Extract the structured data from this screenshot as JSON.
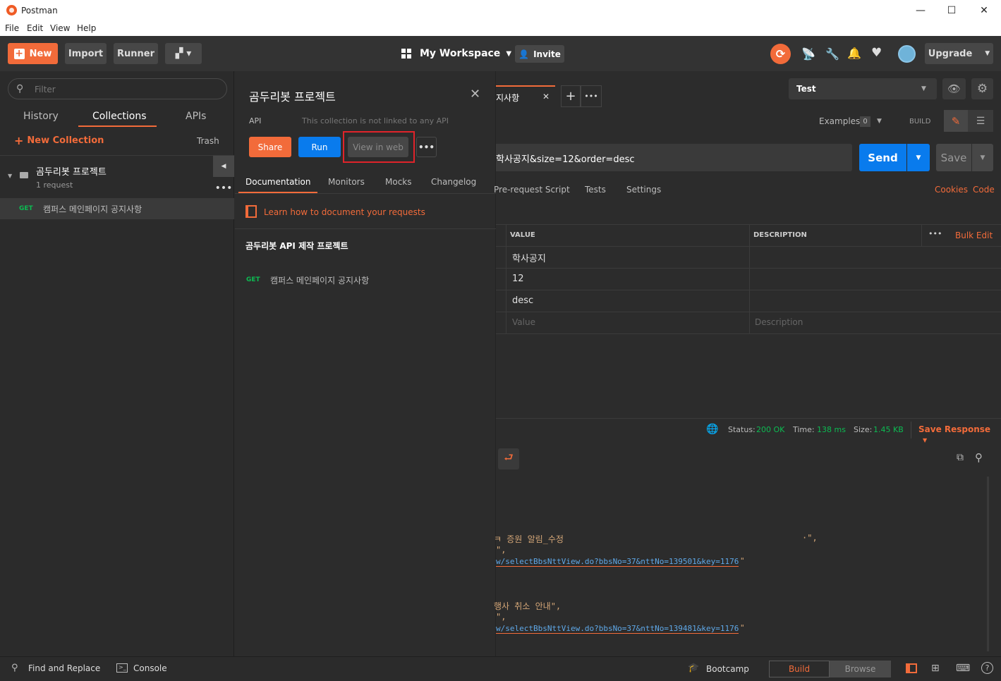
{
  "window": {
    "title": "Postman",
    "minimize": "—",
    "maximize": "☐",
    "close": "✕"
  },
  "menu": [
    "File",
    "Edit",
    "View",
    "Help"
  ],
  "toolbar": {
    "new_label": "New",
    "import_label": "Import",
    "runner_label": "Runner",
    "workspace_label": "My Workspace",
    "invite_label": "Invite",
    "upgrade_label": "Upgrade"
  },
  "sidebar": {
    "filter_placeholder": "Filter",
    "tabs": [
      "History",
      "Collections",
      "APIs"
    ],
    "new_collection": "New Collection",
    "trash": "Trash",
    "collection": {
      "name": "곰두리봇 프로젝트",
      "count": "1 request"
    },
    "request": {
      "method": "GET",
      "name": "캠퍼스 메인페이지 공지사항"
    }
  },
  "panel": {
    "title": "곰두리봇 프로젝트",
    "api_label": "API",
    "api_note": "This collection is not linked to any API",
    "share": "Share",
    "run": "Run",
    "view_web": "View in web",
    "tabs": [
      "Documentation",
      "Monitors",
      "Mocks",
      "Changelog"
    ],
    "learn": "Learn how to document your requests",
    "doc_title": "곰두리봇 API 제작 프로젝트",
    "doc_method": "GET",
    "doc_request": "캠퍼스 메인페이지 공지사항"
  },
  "main": {
    "tab_label": "지사항",
    "env": "Test",
    "examples": "Examples",
    "examples_count": "0",
    "build": "BUILD",
    "url": "학사공지&size=12&order=desc",
    "send": "Send",
    "save": "Save",
    "subtabs": [
      "Pre-request Script",
      "Tests",
      "Settings"
    ],
    "cookies": "Cookies",
    "code": "Code",
    "headers": {
      "value": "VALUE",
      "description": "DESCRIPTION",
      "bulk": "Bulk Edit"
    },
    "rows": [
      "학사공지",
      "12",
      "desc"
    ],
    "placeholders": {
      "value": "Value",
      "description": "Description"
    },
    "status_label": "Status:",
    "status": "200 OK",
    "time_label": "Time:",
    "time": "138 ms",
    "size_label": "Size:",
    "size": "1.45 KB",
    "save_response": "Save Response",
    "body_lines": [
      {
        "text": "ㅋ 증원 알림_수정",
        "tail": "·\","
      },
      {
        "text": "\","
      },
      {
        "link": "w/selectBbsNttView.do?bbsNo=37&nttNo=139501&key=1176",
        "q": "\""
      },
      {
        "text": " 행사 취소 안내\","
      },
      {
        "text": "\","
      },
      {
        "link": "w/selectBbsNttView.do?bbsNo=37&nttNo=139481&key=1176",
        "q": "\""
      }
    ]
  },
  "statusbar": {
    "find": "Find and Replace",
    "console": "Console",
    "bootcamp": "Bootcamp",
    "build": "Build",
    "browse": "Browse"
  },
  "colors": {
    "accent": "#f26b3a",
    "blue": "#097bed",
    "green": "#0cbb52",
    "highlight": "#e0232a"
  }
}
